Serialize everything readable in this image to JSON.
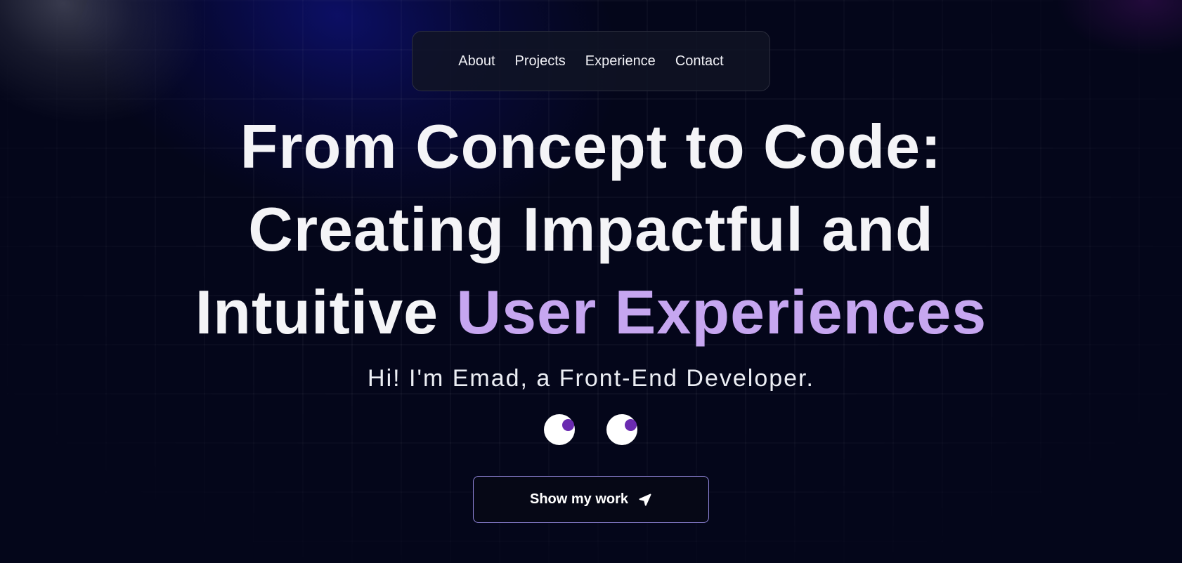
{
  "nav": {
    "items": [
      {
        "label": "About"
      },
      {
        "label": "Projects"
      },
      {
        "label": "Experience"
      },
      {
        "label": "Contact"
      }
    ]
  },
  "hero": {
    "line1": "From Concept to Code:",
    "line2": "Creating Impactful and",
    "line3_plain": "Intuitive ",
    "line3_accent": "User Experiences",
    "subtitle": "Hi! I'm Emad, a Front-End Developer."
  },
  "cta": {
    "label": "Show my work",
    "icon": "send-arrow-icon"
  },
  "colors": {
    "background": "#04061a",
    "accent": "#c6a6f0",
    "pupil": "#6a2bb0",
    "button_border": "#8f84d8"
  }
}
